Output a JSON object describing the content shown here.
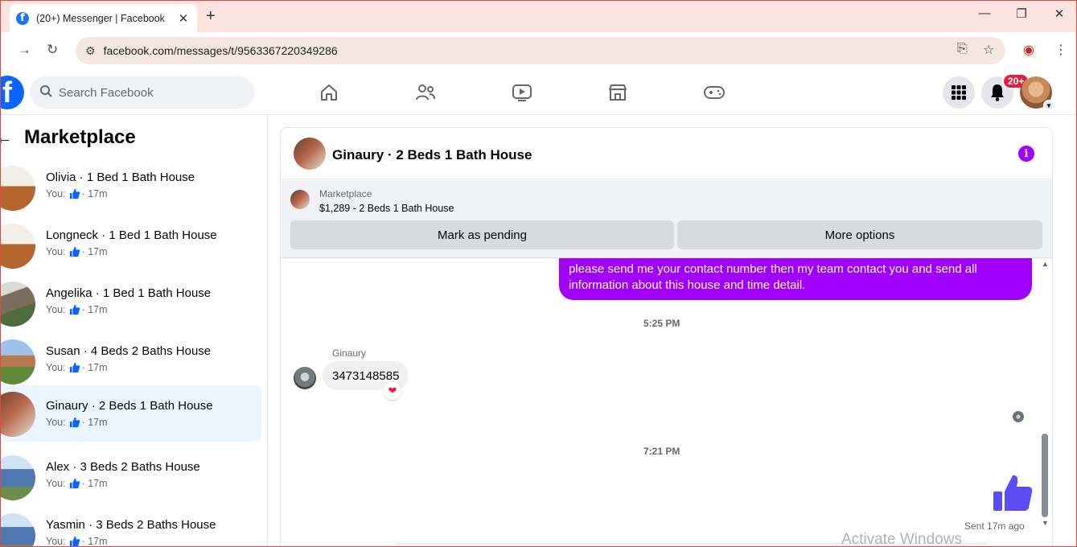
{
  "browser": {
    "tab_title": "(20+) Messenger | Facebook",
    "url": "facebook.com/messages/t/9563367220349286"
  },
  "header": {
    "search_placeholder": "Search Facebook",
    "notification_badge": "20+"
  },
  "sidebar": {
    "title": "Marketplace",
    "conversations": [
      {
        "name": "Olivia · 1 Bed 1 Bath House",
        "prefix": "You:",
        "time": "· 17m"
      },
      {
        "name": "Longneck · 1 Bed 1 Bath House",
        "prefix": "You:",
        "time": "· 17m"
      },
      {
        "name": "Angelika · 1 Bed 1 Bath House",
        "prefix": "You:",
        "time": "· 17m"
      },
      {
        "name": "Susan · 4 Beds 2 Baths House",
        "prefix": "You:",
        "time": "· 17m"
      },
      {
        "name": "Ginaury · 2 Beds 1 Bath House",
        "prefix": "You:",
        "time": "· 17m"
      },
      {
        "name": "Alex · 3 Beds 2 Baths House",
        "prefix": "You:",
        "time": "· 17m"
      },
      {
        "name": "Yasmin · 3 Beds 2 Baths House",
        "prefix": "You:",
        "time": "· 17m"
      }
    ]
  },
  "chat": {
    "title": "Ginaury · 2 Beds 1 Bath House",
    "listing_label": "Marketplace",
    "listing_price": "$1,289 - 2 Beds 1 Bath House",
    "mark_pending": "Mark as pending",
    "more_options": "More options",
    "outgoing_message": "please send me your contact number then my team contact you and send all information about this house and time detail.",
    "time_1": "5:25 PM",
    "sender_name": "Ginaury",
    "incoming_message": "3473148585",
    "time_2": "7:21 PM",
    "sent_status": "Sent 17m ago"
  },
  "watermark": "Activate Windows",
  "colors": {
    "accent": "#a100ff",
    "fb_blue": "#0866ff",
    "like_blue": "#5b4cf5"
  }
}
